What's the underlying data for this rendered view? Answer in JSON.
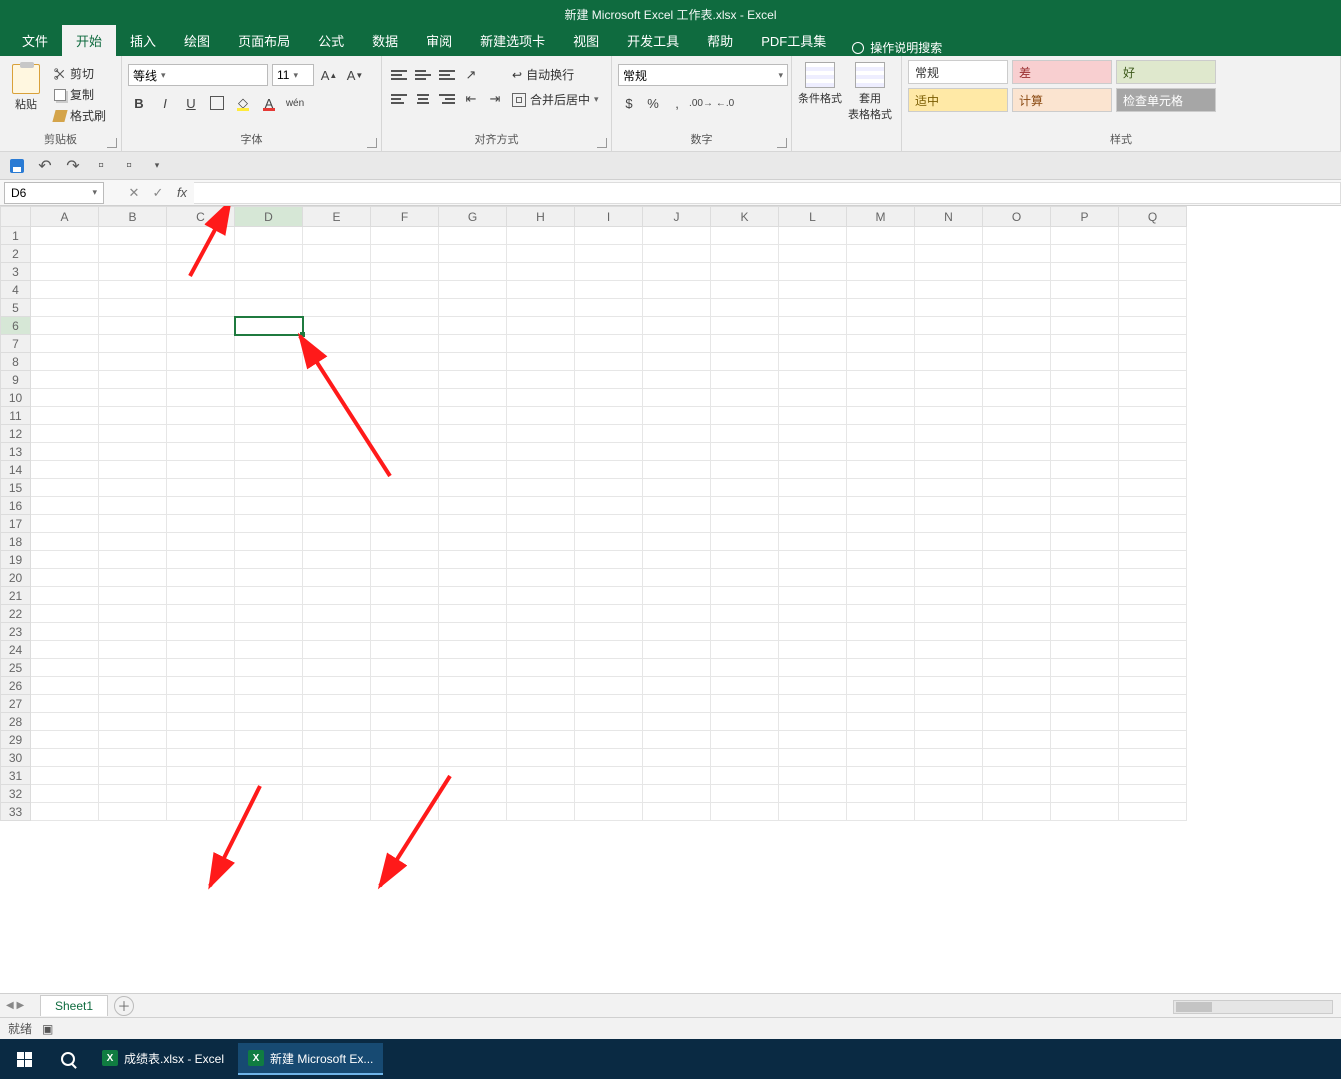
{
  "title": {
    "doc_name": "新建 Microsoft Excel 工作表.xlsx",
    "app": "Excel",
    "separator": "  -  "
  },
  "tabs": {
    "file": "文件",
    "home": "开始",
    "insert": "插入",
    "draw": "绘图",
    "layout": "页面布局",
    "formulas": "公式",
    "data": "数据",
    "review": "审阅",
    "newtab": "新建选项卡",
    "view": "视图",
    "developer": "开发工具",
    "help": "帮助",
    "pdf": "PDF工具集",
    "tellme": "操作说明搜索"
  },
  "ribbon": {
    "clipboard": {
      "paste": "粘贴",
      "cut": "剪切",
      "copy": "复制",
      "painter": "格式刷",
      "group": "剪贴板"
    },
    "font": {
      "name": "等线",
      "size": "11",
      "group": "字体"
    },
    "align": {
      "wrap": "自动换行",
      "merge": "合并后居中",
      "group": "对齐方式"
    },
    "number": {
      "format": "常规",
      "group": "数字"
    },
    "styles": {
      "cond": "条件格式",
      "table": "套用\n表格格式",
      "group": "样式",
      "normal": "常规",
      "bad": "差",
      "good": "好",
      "neutral": "适中",
      "calc": "计算",
      "check": "检查单元格"
    }
  },
  "namebox": "D6",
  "columns": [
    "A",
    "B",
    "C",
    "D",
    "E",
    "F",
    "G",
    "H",
    "I",
    "J",
    "K",
    "L",
    "M",
    "N",
    "O",
    "P",
    "Q"
  ],
  "rows": 33,
  "selected": {
    "col": "D",
    "row": 6
  },
  "sheet_tab": "Sheet1",
  "status": "就绪",
  "taskbar": {
    "task1": "成绩表.xlsx - Excel",
    "task2": "新建 Microsoft Ex..."
  }
}
